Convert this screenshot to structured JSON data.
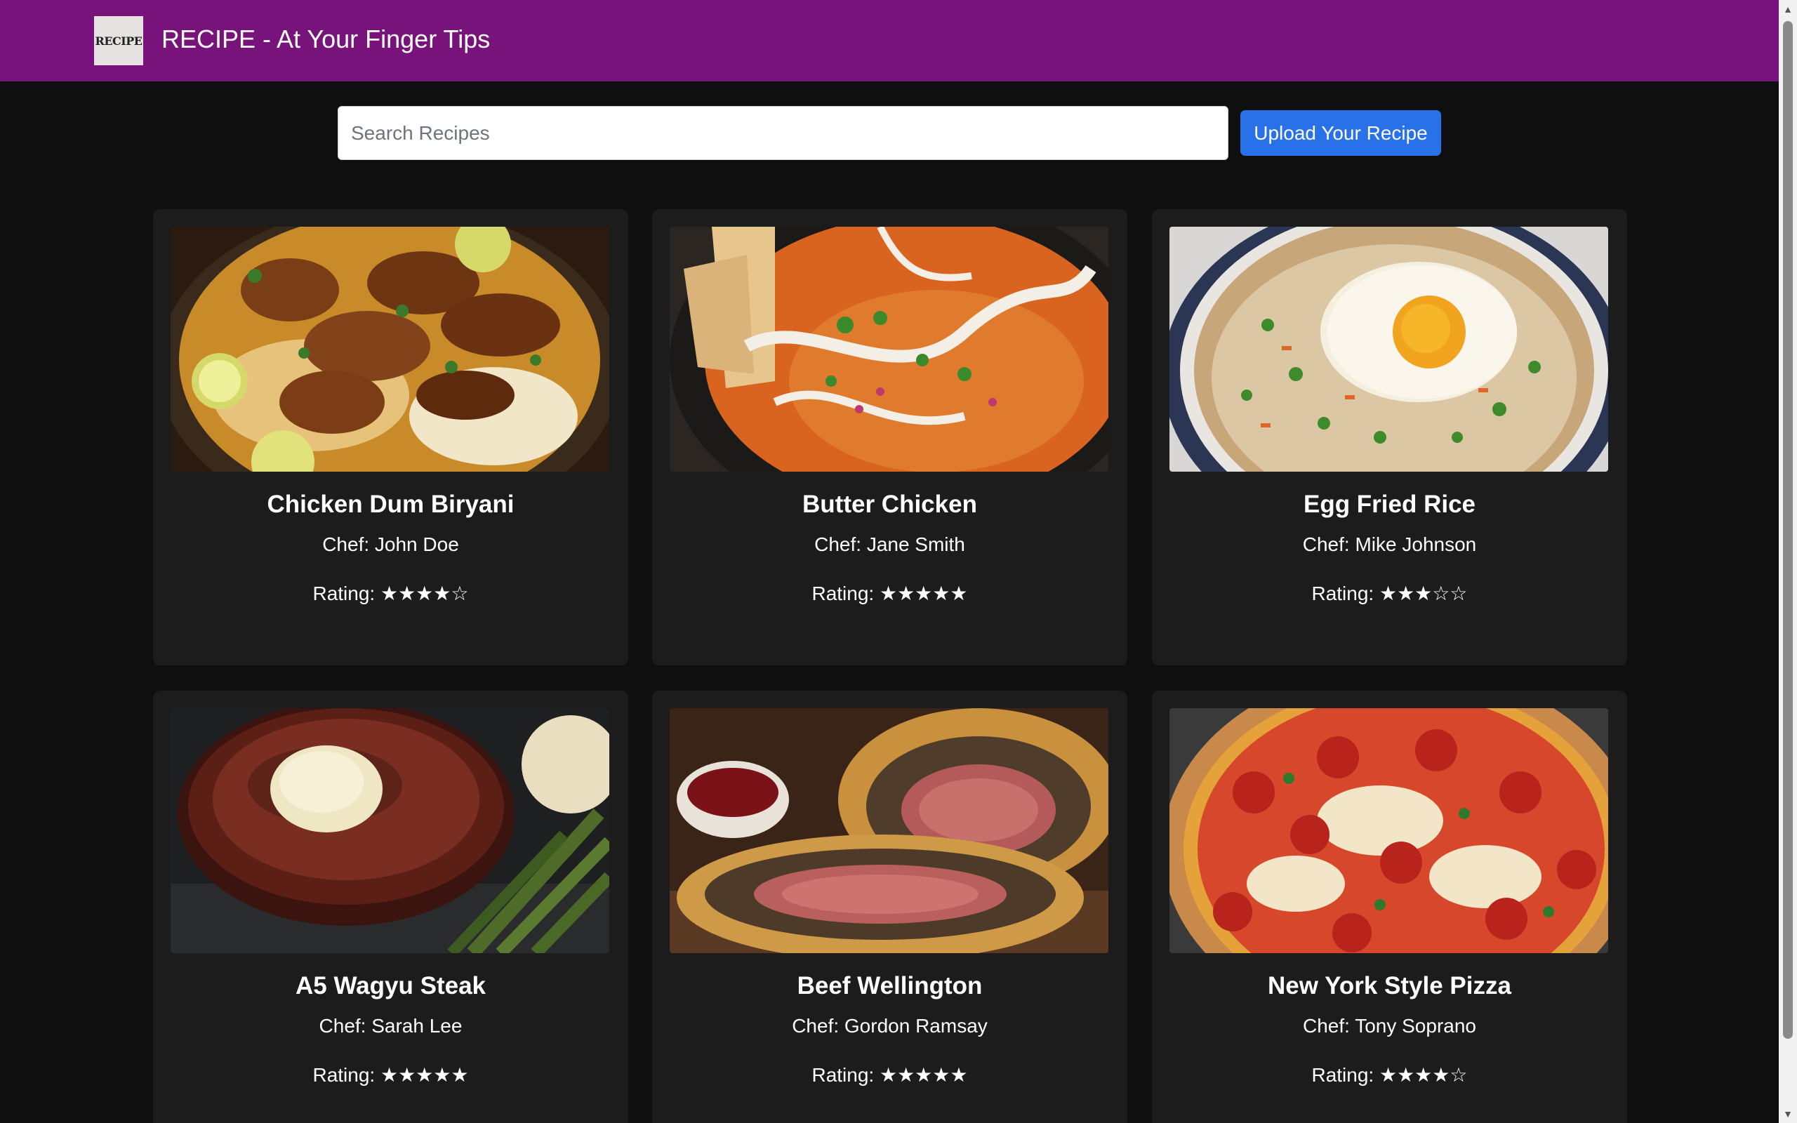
{
  "header": {
    "logo_text": "RECIPE",
    "title": "RECIPE - At Your Finger Tips",
    "background_color": "#77137b"
  },
  "search": {
    "placeholder": "Search Recipes",
    "value": ""
  },
  "upload_button": {
    "label": "Upload Your Recipe",
    "color": "#2871e8"
  },
  "recipes": [
    {
      "title": "Chicken Dum Biryani",
      "chef": "Chef: John Doe",
      "rating": "Rating: ★★★★☆",
      "image_icon": "biryani-image"
    },
    {
      "title": "Butter Chicken",
      "chef": "Chef: Jane Smith",
      "rating": "Rating: ★★★★★",
      "image_icon": "butter-chicken-image"
    },
    {
      "title": "Egg Fried Rice",
      "chef": "Chef: Mike Johnson",
      "rating": "Rating: ★★★☆☆",
      "image_icon": "fried-rice-image"
    },
    {
      "title": "A5 Wagyu Steak",
      "chef": "Chef: Sarah Lee",
      "rating": "Rating: ★★★★★",
      "image_icon": "steak-image"
    },
    {
      "title": "Beef Wellington",
      "chef": "Chef: Gordon Ramsay",
      "rating": "Rating: ★★★★★",
      "image_icon": "wellington-image"
    },
    {
      "title": "New York Style Pizza",
      "chef": "Chef: Tony Soprano",
      "rating": "Rating: ★★★★☆",
      "image_icon": "pizza-image"
    }
  ],
  "colors": {
    "page_background": "#0f0f0f",
    "card_background": "#1c1c1c"
  }
}
